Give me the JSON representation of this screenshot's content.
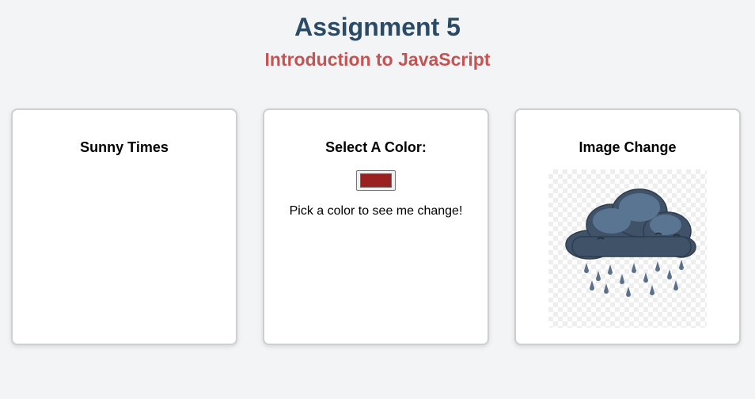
{
  "header": {
    "title": "Assignment 5",
    "subtitle": "Introduction to JavaScript"
  },
  "cards": [
    {
      "title": "Sunny Times"
    },
    {
      "title": "Select A Color:",
      "color_value": "#9b2121",
      "caption": "Pick a color to see me change!"
    },
    {
      "title": "Image Change",
      "image_icon": "rain-cloud-icon"
    }
  ],
  "colors": {
    "title": "#2b4a66",
    "subtitle": "#c65353",
    "background": "#f3f4f6",
    "selected_color": "#9b2121",
    "cloud": "#4a6078"
  }
}
